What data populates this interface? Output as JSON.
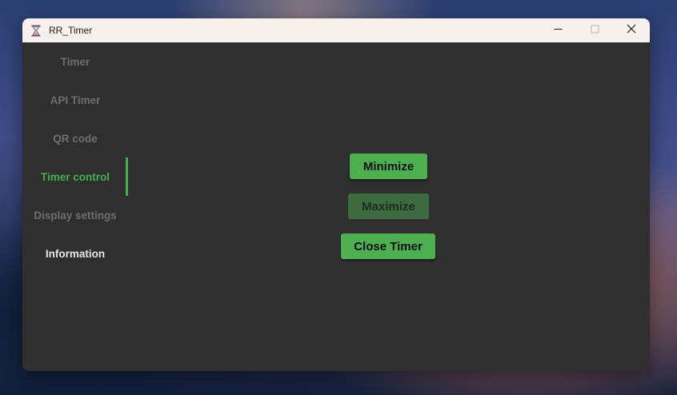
{
  "window": {
    "title": "RR_Timer",
    "app_icon": "hourglass-icon"
  },
  "caption_buttons": {
    "minimize_icon": "minimize-icon",
    "maximize_icon": "maximize-icon",
    "close_icon": "close-icon"
  },
  "sidebar": {
    "items": [
      {
        "label": "Timer"
      },
      {
        "label": "API Timer"
      },
      {
        "label": "QR code"
      },
      {
        "label": "Timer control",
        "active": true
      },
      {
        "label": "Display settings"
      },
      {
        "label": "Information"
      }
    ]
  },
  "main": {
    "minimize_label": "Minimize",
    "maximize_label": "Maximize",
    "close_timer_label": "Close Timer",
    "maximize_enabled": false
  },
  "colors": {
    "accent": "#4caf50",
    "active_text": "#43b04f",
    "background": "#2f2f2f",
    "titlebar": "#f6f1ec"
  }
}
